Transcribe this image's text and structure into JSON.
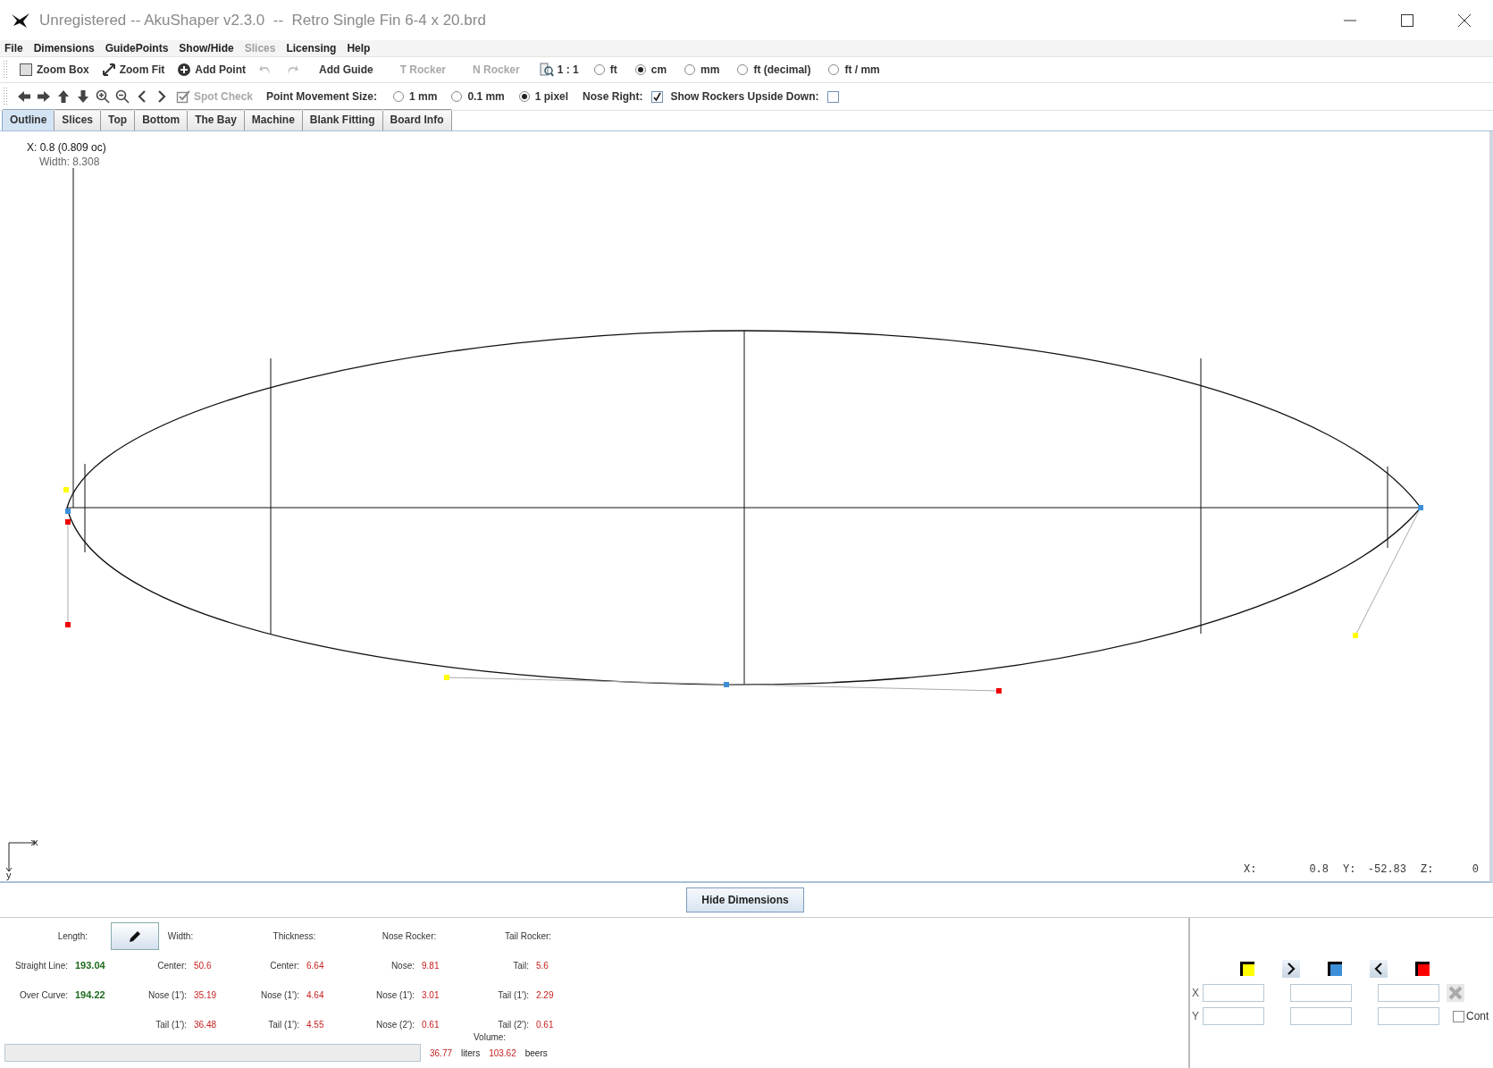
{
  "window": {
    "title": "Unregistered -- AkuShaper v2.3.0  --  Retro Single Fin 6-4 x 20.brd"
  },
  "menu": [
    {
      "label": "File",
      "disabled": false
    },
    {
      "label": "Dimensions",
      "disabled": false
    },
    {
      "label": "GuidePoints",
      "disabled": false
    },
    {
      "label": "Show/Hide",
      "disabled": false
    },
    {
      "label": "Slices",
      "disabled": true
    },
    {
      "label": "Licensing",
      "disabled": false
    },
    {
      "label": "Help",
      "disabled": false
    }
  ],
  "toolbar": {
    "buttons": [
      {
        "kind": "zoom-box",
        "label": "Zoom Box",
        "disabled": false
      },
      {
        "kind": "zoom-fit",
        "label": "Zoom Fit",
        "disabled": false
      },
      {
        "kind": "add-point",
        "label": "Add Point",
        "disabled": false
      },
      {
        "kind": "undo",
        "disabled": true
      },
      {
        "kind": "redo",
        "disabled": true
      },
      {
        "kind": "text",
        "label": "Add Guide",
        "disabled": false
      },
      {
        "kind": "text",
        "label": "T Rocker",
        "disabled": true
      },
      {
        "kind": "text",
        "label": "N Rocker",
        "disabled": true
      },
      {
        "kind": "scale",
        "label": "1 : 1",
        "disabled": false
      }
    ],
    "units": [
      {
        "label": "ft",
        "selected": false
      },
      {
        "label": "cm",
        "selected": true
      },
      {
        "label": "mm",
        "selected": false
      },
      {
        "label": "ft (decimal)",
        "selected": false
      },
      {
        "label": "ft / mm",
        "selected": false
      }
    ]
  },
  "toolbar2": {
    "nav": [
      {
        "kind": "left"
      },
      {
        "kind": "right"
      },
      {
        "kind": "up"
      },
      {
        "kind": "down"
      },
      {
        "kind": "zoom-in"
      },
      {
        "kind": "zoom-out"
      },
      {
        "kind": "prev"
      },
      {
        "kind": "next"
      }
    ],
    "spot_check": {
      "label": "Spot Check",
      "disabled": true
    },
    "point_movement": {
      "label": "Point Movement Size:",
      "options": [
        {
          "label": "1 mm",
          "selected": false
        },
        {
          "label": "0.1 mm",
          "selected": false
        },
        {
          "label": "1 pixel",
          "selected": true
        }
      ]
    },
    "nose_right": {
      "label": "Nose Right:",
      "checked": true
    },
    "upside_down": {
      "label": "Show Rockers Upside Down:",
      "checked": false
    }
  },
  "tabs": [
    {
      "label": "Outline",
      "selected": true
    },
    {
      "label": "Slices",
      "selected": false
    },
    {
      "label": "Top",
      "selected": false
    },
    {
      "label": "Bottom",
      "selected": false
    },
    {
      "label": "The Bay",
      "selected": false
    },
    {
      "label": "Machine",
      "selected": false
    },
    {
      "label": "Blank Fitting",
      "selected": false
    },
    {
      "label": "Board Info",
      "selected": false
    }
  ],
  "canvas": {
    "readout_x": "X: 0.8 (0.809 oc)",
    "readout_width": "Width: 8.308",
    "axis_x": "x",
    "axis_y": "y",
    "status": [
      {
        "label": "X:",
        "value": "0.8"
      },
      {
        "label": "Y:",
        "value": "-52.83"
      },
      {
        "label": "Z:",
        "value": "0"
      }
    ]
  },
  "hide_dimensions": "Hide Dimensions",
  "dimensions": {
    "groups": [
      {
        "title": "Length:",
        "kind": "length",
        "rows": [
          {
            "label": "Straight Line:",
            "value": "193.04"
          },
          {
            "label": "Over Curve:",
            "value": "194.22"
          }
        ]
      },
      {
        "title": "Width:",
        "kind": "measure",
        "rows": [
          {
            "label": "Center:",
            "value": "50.6"
          },
          {
            "label": "Nose (1'):",
            "value": "35.19"
          },
          {
            "label": "Tail (1'):",
            "value": "36.48"
          }
        ]
      },
      {
        "title": "Thickness:",
        "kind": "measure",
        "rows": [
          {
            "label": "Center:",
            "value": "6.64"
          },
          {
            "label": "Nose (1'):",
            "value": "4.64"
          },
          {
            "label": "Tail (1'):",
            "value": "4.55"
          }
        ]
      },
      {
        "title": "Nose Rocker:",
        "kind": "measure",
        "rows": [
          {
            "label": "Nose:",
            "value": "9.81"
          },
          {
            "label": "Nose (1'):",
            "value": "3.01"
          },
          {
            "label": "Nose (2'):",
            "value": "0.61"
          }
        ]
      },
      {
        "title": "Tail Rocker:",
        "kind": "measure",
        "rows": [
          {
            "label": "Tail:",
            "value": "5.6"
          },
          {
            "label": "Tail (1'):",
            "value": "2.29"
          },
          {
            "label": "Tail (2'):",
            "value": "0.61"
          }
        ]
      }
    ],
    "volume_label": "Volume:",
    "volume": [
      {
        "value": "36.77",
        "unit": "liters"
      },
      {
        "value": "103.62",
        "unit": "beers"
      }
    ]
  },
  "point_editor": {
    "controls": [
      {
        "kind": "swatch",
        "color": "#ffff00"
      },
      {
        "kind": "next"
      },
      {
        "kind": "swatch",
        "color": "#3c8fd8"
      },
      {
        "kind": "prev"
      },
      {
        "kind": "swatch",
        "color": "#ff0000"
      }
    ],
    "row_labels": [
      "X",
      "Y"
    ],
    "cont": {
      "label": "Cont",
      "checked": false
    }
  }
}
